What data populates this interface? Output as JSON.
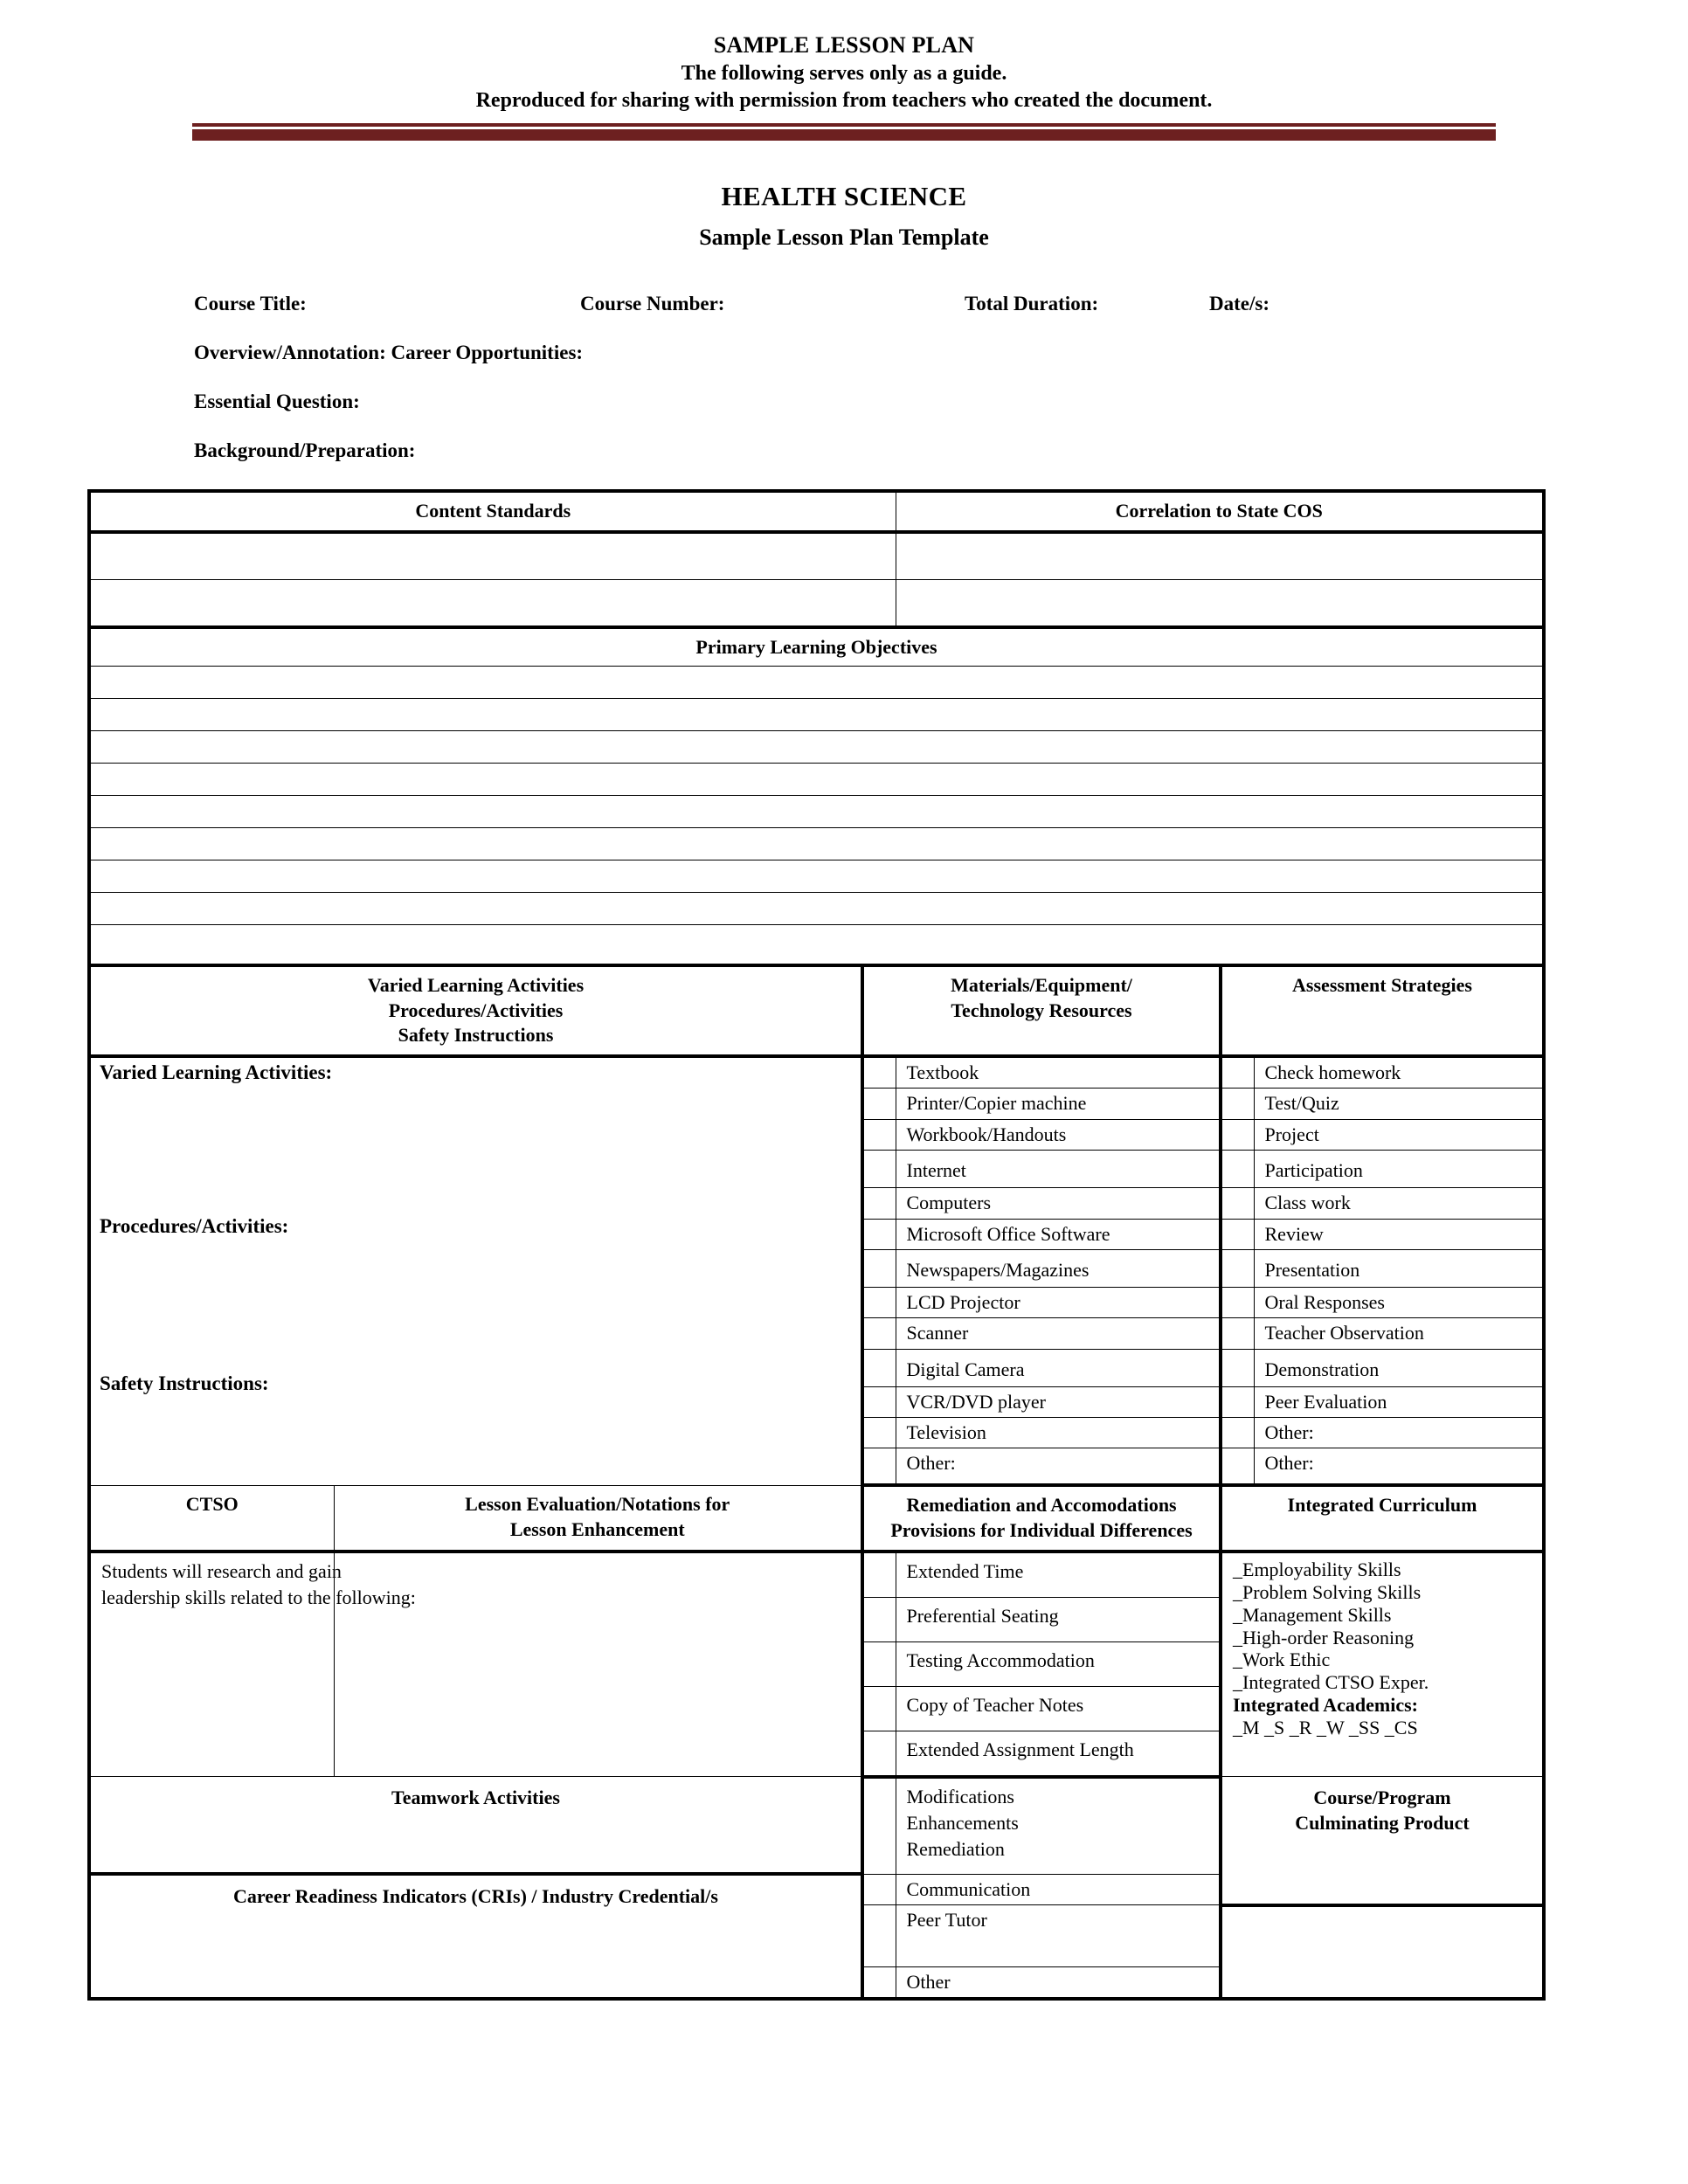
{
  "banner": {
    "line1": "SAMPLE LESSON PLAN",
    "line2": "The following serves only as a guide.",
    "line3": "Reproduced for sharing with permission from teachers who created the document.",
    "rule_color": "#6d2020"
  },
  "title": {
    "main": "HEALTH SCIENCE",
    "sub": "Sample Lesson Plan Template"
  },
  "fields": {
    "course_title": "Course Title:",
    "course_number": "Course Number:",
    "total_duration": "Total Duration:",
    "dates": "Date/s:",
    "overview": "Overview/Annotation:  Career Opportunities:",
    "essential_question": "Essential Question:",
    "background": "Background/Preparation:"
  },
  "content_standards": {
    "header_left": "Content Standards",
    "header_right": "Correlation to State COS",
    "rows": 2
  },
  "primary_objectives": {
    "header": "Primary Learning Objectives",
    "rows": 9
  },
  "activities": {
    "header_left_line1": "Varied Learning Activities",
    "header_left_line2": "Procedures/Activities",
    "header_left_line3": "Safety Instructions",
    "header_materials_line1": "Materials/Equipment/",
    "header_materials_line2": "Technology Resources",
    "header_assessment": "Assessment Strategies",
    "label_varied": "Varied Learning Activities:",
    "label_procedures": "Procedures/Activities:",
    "label_safety": "Safety Instructions:",
    "materials": [
      "Textbook",
      "Printer/Copier machine",
      "Workbook/Handouts",
      "Internet",
      "Computers",
      "Microsoft Office Software",
      "Newspapers/Magazines",
      "LCD Projector",
      "Scanner",
      "Digital Camera",
      "VCR/DVD player",
      "Television",
      "Other:"
    ],
    "assessment": [
      "Check homework",
      "Test/Quiz",
      "Project",
      "Participation",
      "Class work",
      "Review",
      "Presentation",
      "Oral Responses",
      "Teacher Observation",
      "Demonstration",
      "Peer Evaluation",
      "Other:",
      "Other:"
    ]
  },
  "lower": {
    "header_ctso": "CTSO",
    "header_lesson_eval_line1": "Lesson Evaluation/Notations for",
    "header_lesson_eval_line2": "Lesson Enhancement",
    "header_remediation_line1": "Remediation and Accomodations",
    "header_remediation_line2": "Provisions for Individual Differences",
    "header_integrated": "Integrated Curriculum",
    "ctso_text_line1": "Students will research and gain",
    "ctso_text_line2": "leadership skills related to the following:",
    "remediation_items": [
      "Extended Time",
      "Preferential Seating",
      "Testing Accommodation",
      "Copy of Teacher Notes",
      "Extended Assignment Length"
    ],
    "integrated_items": [
      "_Employability Skills",
      "_Problem Solving Skills",
      "_Management Skills",
      "_High-order Reasoning",
      "_Work Ethic",
      "_Integrated CTSO Exper."
    ],
    "integrated_academics_label": "Integrated Academics:",
    "integrated_academics_codes": "_M  _S  _R  _W  _SS  _CS",
    "header_teamwork": "Teamwork Activities",
    "mod_items": [
      "Modifications",
      "Enhancements",
      "Remediation"
    ],
    "culminating_line1": "Course/Program",
    "culminating_line2": "Culminating Product",
    "header_cri": "Career Readiness Indicators (CRIs) / Industry Credential/s",
    "cri_side_items": [
      "Communication",
      "Peer Tutor",
      "Other"
    ]
  }
}
